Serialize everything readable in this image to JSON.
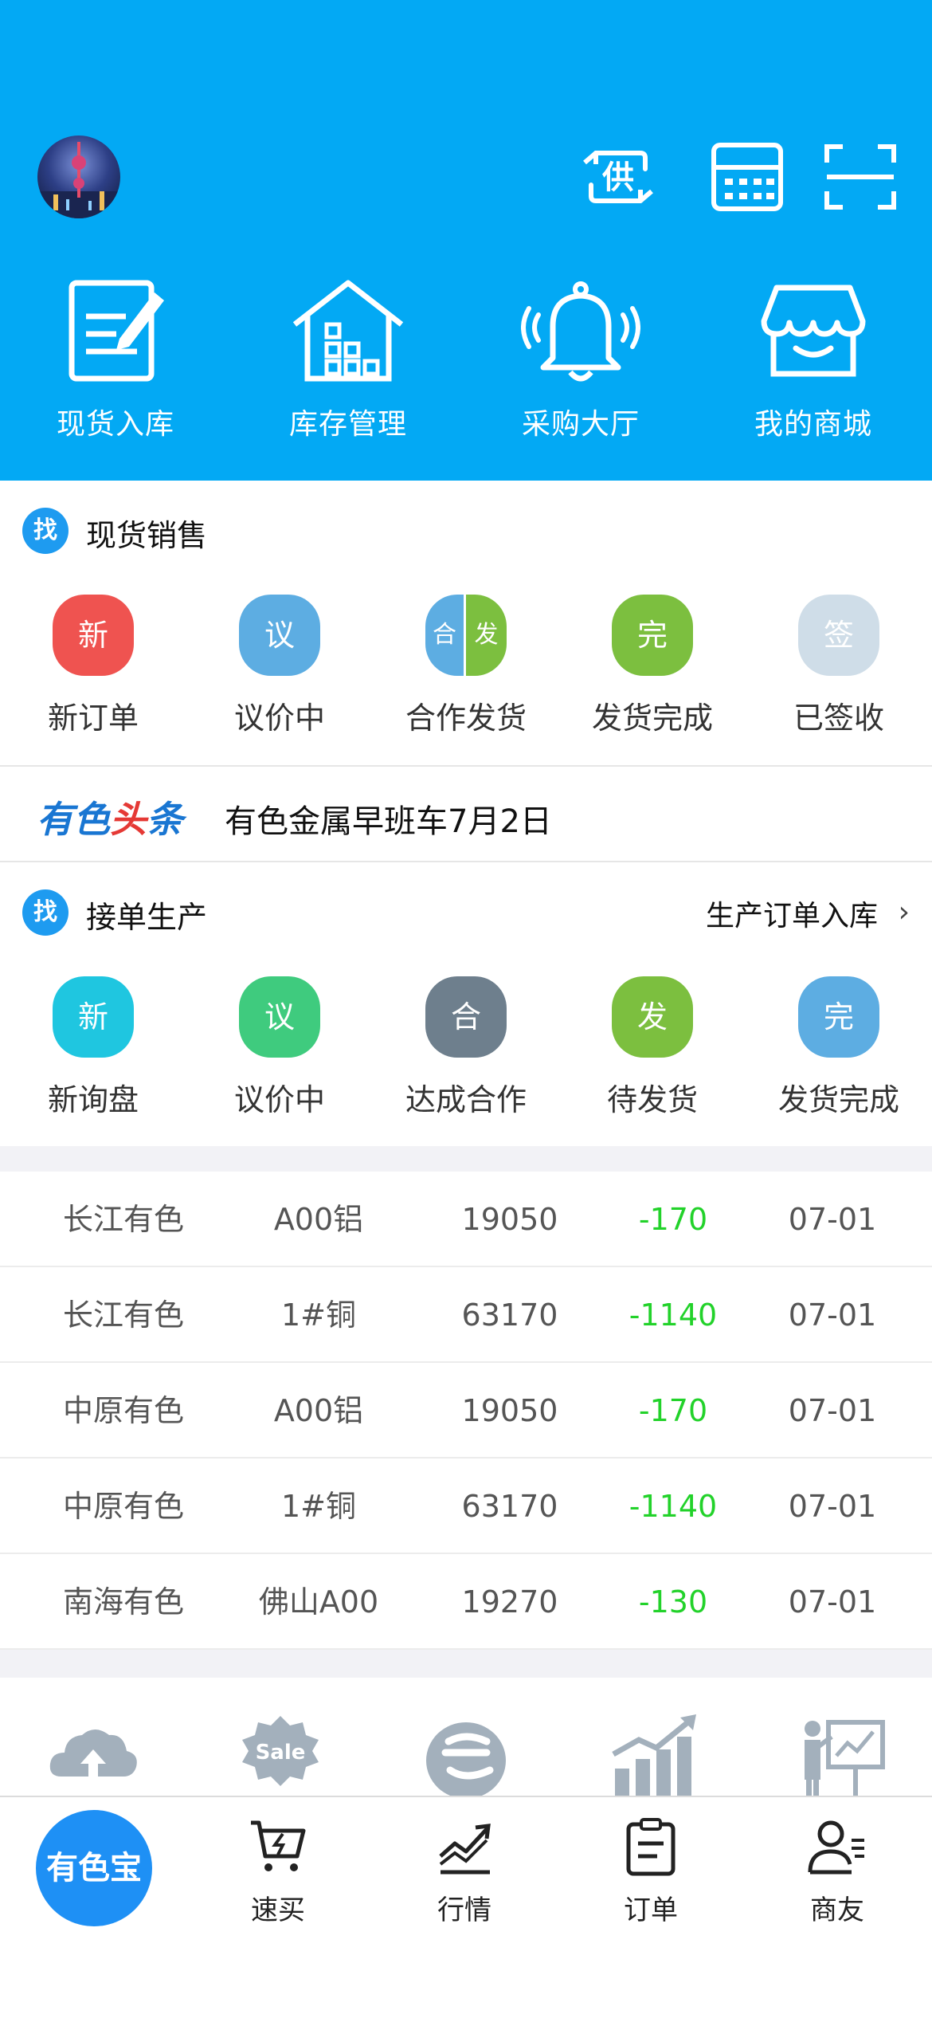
{
  "header": {
    "top_icons": [
      {
        "icon": "supply-swap-icon",
        "label": "供"
      },
      {
        "icon": "calculator-icon"
      },
      {
        "icon": "scan-icon"
      }
    ],
    "quick_actions": [
      {
        "label": "现货入库",
        "icon": "document-edit-icon"
      },
      {
        "label": "库存管理",
        "icon": "warehouse-icon"
      },
      {
        "label": "采购大厅",
        "icon": "bell-icon"
      },
      {
        "label": "我的商城",
        "icon": "store-icon"
      }
    ]
  },
  "spot_sales": {
    "badge": "找",
    "title": "现货销售",
    "statuses": [
      {
        "badge": "新",
        "label": "新订单",
        "color": "#EF5350"
      },
      {
        "badge_left": "合",
        "badge_right": "发",
        "label": "合作发货",
        "color_left": "#5DADE2",
        "color_right": "#7CBF3F"
      },
      {
        "badge": "议",
        "label": "议价中",
        "color": "#5DADE2"
      },
      {
        "badge": "完",
        "label": "发货完成",
        "color": "#7CBF3F"
      },
      {
        "badge": "签",
        "label": "已签收",
        "color": "#CFDDE8"
      }
    ]
  },
  "news": {
    "brand_1": "有色",
    "brand_2": "头",
    "brand_3": "条",
    "headline": "有色金属早班车7月2日"
  },
  "production": {
    "badge": "找",
    "title": "接单生产",
    "link": "生产订单入库",
    "statuses": [
      {
        "badge": "新",
        "label": "新询盘",
        "color": "#1FC6E0"
      },
      {
        "badge": "议",
        "label": "议价中",
        "color": "#3FCB7E"
      },
      {
        "badge": "合",
        "label": "达成合作",
        "color": "#6E7F8D"
      },
      {
        "badge": "发",
        "label": "待发货",
        "color": "#7CBF3F"
      },
      {
        "badge": "完",
        "label": "发货完成",
        "color": "#5DADE2"
      }
    ]
  },
  "prices": {
    "rows": [
      {
        "market": "长江有色",
        "product": "A00铝",
        "price": "19050",
        "change": "-170",
        "date": "07-01"
      },
      {
        "market": "长江有色",
        "product": "1#铜",
        "price": "63170",
        "change": "-1140",
        "date": "07-01"
      },
      {
        "market": "中原有色",
        "product": "A00铝",
        "price": "19050",
        "change": "-170",
        "date": "07-01"
      },
      {
        "market": "中原有色",
        "product": "1#铜",
        "price": "63170",
        "change": "-1140",
        "date": "07-01"
      },
      {
        "market": "南海有色",
        "product": "佛山A00",
        "price": "19270",
        "change": "-130",
        "date": "07-01"
      }
    ],
    "change_color": "#22D22A"
  },
  "promo": {
    "items": [
      {
        "icon": "cloud-upload-icon"
      },
      {
        "icon": "sale-badge-icon",
        "label": "Sale"
      },
      {
        "icon": "e-logo-icon"
      },
      {
        "icon": "growth-chart-icon"
      },
      {
        "icon": "presentation-icon"
      }
    ]
  },
  "tabbar": {
    "home_label": "有色宝",
    "tabs": [
      {
        "label": "速买",
        "icon": "quick-buy-cart-icon"
      },
      {
        "label": "行情",
        "icon": "market-trend-icon"
      },
      {
        "label": "订单",
        "icon": "clipboard-icon"
      },
      {
        "label": "商友",
        "icon": "contacts-icon"
      }
    ]
  },
  "colors": {
    "header_bg": "#03A9F4",
    "brand_blue": "#1E90F5",
    "negative_change": "#22D22A"
  }
}
